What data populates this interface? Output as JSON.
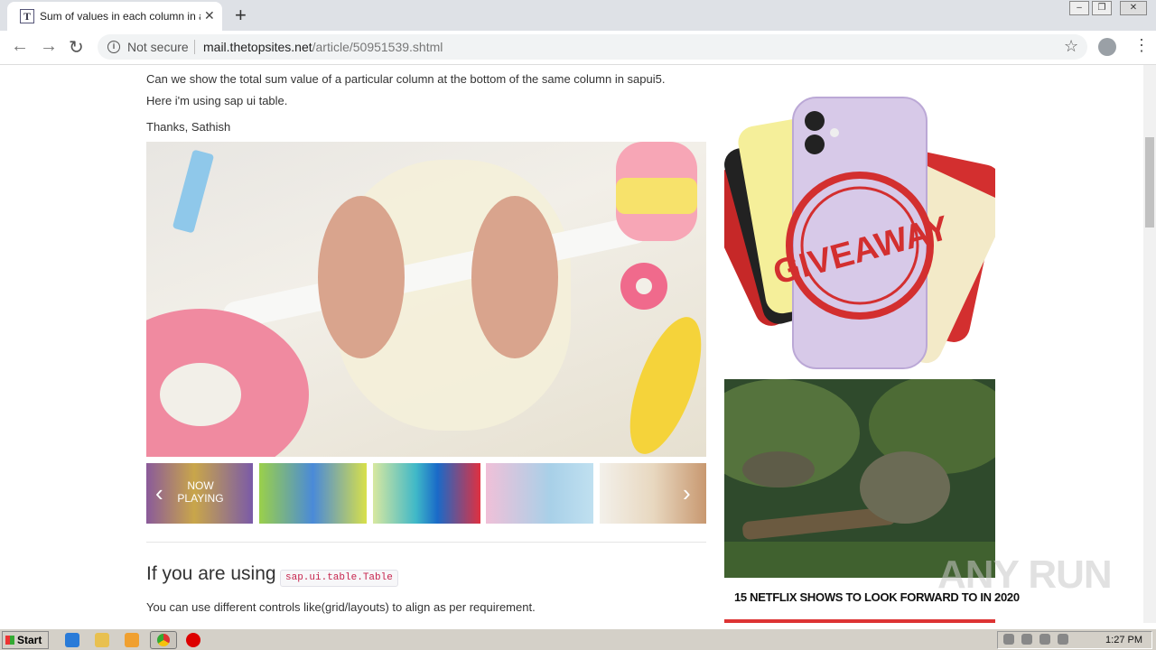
{
  "browser": {
    "tab_title": "Sum of values in each column in a table",
    "tab_favicon": "T",
    "tab_close": "✕",
    "new_tab": "+",
    "not_secure": "Not secure",
    "url_host": "mail.thetopsites.net",
    "url_path": "/article/50951539.shtml",
    "window_minimize": "–",
    "window_restore": "❐",
    "window_close": "✕"
  },
  "article": {
    "line1": "Can we show the total sum value of a particular column at the bottom of the same column in sapui5.",
    "line2": "Here i'm using sap ui table.",
    "line3": "Thanks, Sathish",
    "heading": "If you are using",
    "heading_code": "sap.ui.table.Table",
    "body": "You can use different controls like(grid/layouts) to align as per requirement."
  },
  "video": {
    "now_playing": "NOW PLAYING",
    "prev_arrow": "‹",
    "next_arrow": "›"
  },
  "ads": {
    "giveaway_text": "GIVEAWAY",
    "dino_caption": "15 NETFLIX SHOWS TO LOOK FORWARD TO IN 2020"
  },
  "watermark": "ANY RUN",
  "taskbar": {
    "start_label": "Start",
    "clock": "1:27 PM"
  },
  "icons": {
    "back": "back-arrow-icon",
    "forward": "forward-arrow-icon",
    "reload": "reload-icon",
    "info": "info-icon",
    "star": "bookmark-star-icon",
    "profile": "profile-avatar-icon",
    "menu": "kebab-menu-icon"
  }
}
